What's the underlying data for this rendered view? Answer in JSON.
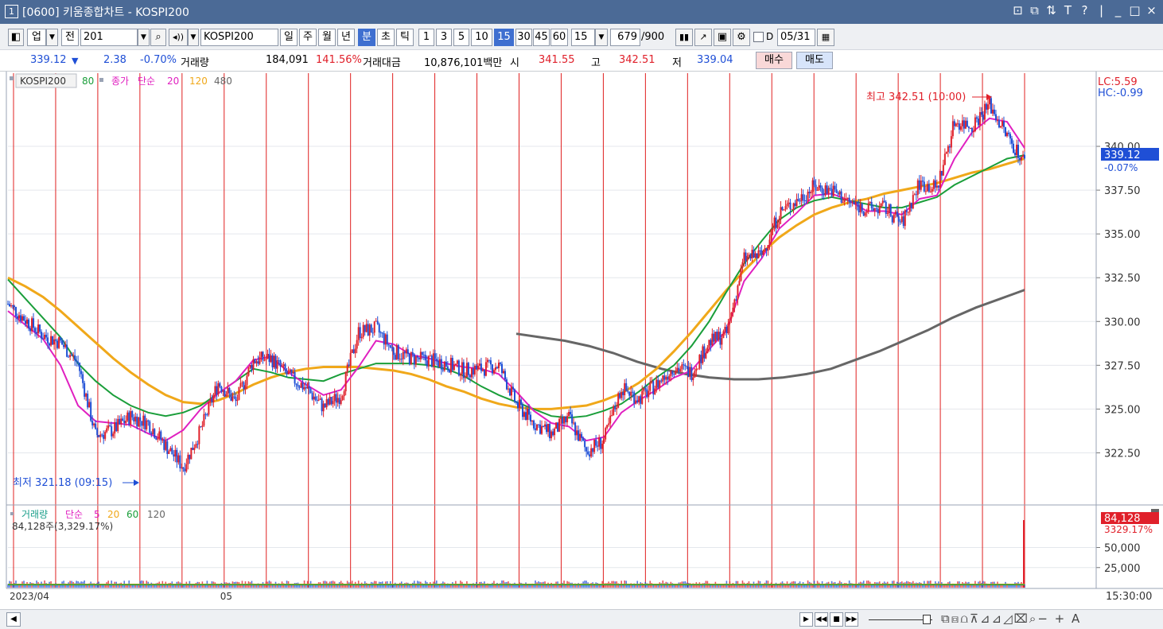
{
  "window": {
    "number": "1",
    "title": "[0600] 키움종합차트 - KOSPI200",
    "controls": [
      "⊡",
      "⧉",
      "⇅",
      "T",
      "?",
      "|",
      "_",
      "□",
      "×"
    ]
  },
  "toolbar": {
    "market": "업",
    "prev_label": "전",
    "code": "201",
    "symbol": "KOSPI200",
    "periods": [
      "일",
      "주",
      "월",
      "년",
      "분",
      "초",
      "틱"
    ],
    "active_period": "분",
    "intervals": [
      "1",
      "3",
      "5",
      "10",
      "15",
      "30",
      "45",
      "60"
    ],
    "active_interval": "15",
    "interval_value": "15",
    "count": "679",
    "count_max": "/900",
    "date_check": "D",
    "date": "05/31"
  },
  "quote": {
    "price": "339.12",
    "arrow": "▼",
    "change": "2.38",
    "change_pct": "-0.70%",
    "volume_label": "거래량",
    "volume": "184,091",
    "volume_ratio": "141.56%",
    "amount_label": "거래대금",
    "amount": "10,876,101백만",
    "open_label": "시",
    "open": "341.55",
    "high_label": "고",
    "high": "342.51",
    "low_label": "저",
    "low": "339.04",
    "buy_label": "매수",
    "sell_label": "매도"
  },
  "price_panel": {
    "legend_symbol": "KOSPI200",
    "legend_ma80": "80",
    "legend_close": "종가",
    "legend_simple": "단순",
    "legend_ma20": "20",
    "legend_ma120": "120",
    "legend_ma480": "480",
    "lc": "LC:5.59",
    "hc": "HC:-0.99",
    "high_annotation": "최고 342.51 (10:00)",
    "low_annotation": "최저 321.18 (09:15)",
    "current_tag": "339.12",
    "current_pct": "-0.07%"
  },
  "volume_panel": {
    "legend_volume": "거래량",
    "legend_simple": "단순",
    "legend_5": "5",
    "legend_20": "20",
    "legend_60": "60",
    "legend_120": "120",
    "value_line": "84,128주(3,329.17%)",
    "current_tag": "84,128",
    "current_pct": "3329.17%"
  },
  "x_axis": {
    "labels": [
      {
        "text": "2023/04",
        "slot": 0
      },
      {
        "text": "05",
        "slot": 5
      }
    ],
    "time": "15:30:00"
  },
  "colors": {
    "up": "#e0202a",
    "down": "#1f4fd6",
    "ma5": "#e020c0",
    "ma20": "#1a9e3a",
    "ma60": "#f0a81a",
    "ma120": "#666666",
    "grid_day": "#e02020",
    "title_bar": "#4b6a96"
  },
  "chart_data": {
    "type": "line",
    "title": "",
    "y_ticks": [
      340.0,
      337.5,
      335.0,
      332.5,
      330.0,
      327.5,
      325.0,
      322.5
    ],
    "y_tick_labels": [
      "340.00",
      "337.50",
      "335.00",
      "332.50",
      "330.00",
      "327.50",
      "325.00",
      "322.50"
    ],
    "ylim": [
      319.57,
      344.27
    ],
    "x_slots": 25,
    "close": [
      331.0,
      330.1,
      329.2,
      328.8,
      327.6,
      323.5,
      323.8,
      324.6,
      324.2,
      322.9,
      321.7,
      323.8,
      326.5,
      325.4,
      327.8,
      327.9,
      326.9,
      326.2,
      325.1,
      325.8,
      329.4,
      329.6,
      328.3,
      327.9,
      327.8,
      327.6,
      327.2,
      327.3,
      327.5,
      325.3,
      324.2,
      323.6,
      324.5,
      322.6,
      323.2,
      326.2,
      325.6,
      326.4,
      327.4,
      327.1,
      328.8,
      329.3,
      333.6,
      333.8,
      336.2,
      336.9,
      337.7,
      337.5,
      336.8,
      336.4,
      336.5,
      335.6,
      337.9,
      337.6,
      341.4,
      341.2,
      342.4,
      340.6,
      339.1
    ],
    "ma_short": [
      330.6,
      329.8,
      329.0,
      327.5,
      325.2,
      324.3,
      324.2,
      324.1,
      323.6,
      323.2,
      323.8,
      325.0,
      325.9,
      326.6,
      327.8,
      328.0,
      327.1,
      326.4,
      325.8,
      326.1,
      327.4,
      328.9,
      328.7,
      328.1,
      327.9,
      327.6,
      327.4,
      327.3,
      327.0,
      326.0,
      324.9,
      324.2,
      324.0,
      323.2,
      323.4,
      324.8,
      325.5,
      326.1,
      326.8,
      327.2,
      328.4,
      329.5,
      332.3,
      333.6,
      335.3,
      336.2,
      337.2,
      337.3,
      336.9,
      336.3,
      336.3,
      336.1,
      337.0,
      337.2,
      339.3,
      340.8,
      341.6,
      341.4,
      339.9
    ],
    "ma20": [
      332.4,
      331.3,
      330.2,
      329.1,
      327.6,
      326.6,
      325.8,
      325.2,
      324.8,
      324.6,
      324.8,
      325.2,
      325.9,
      326.6,
      327.3,
      327.1,
      326.8,
      326.7,
      326.6,
      327.0,
      327.3,
      327.6,
      327.6,
      327.6,
      327.5,
      327.3,
      326.9,
      326.3,
      325.8,
      325.4,
      325.0,
      324.6,
      324.5,
      324.6,
      324.9,
      325.3,
      326.0,
      326.8,
      327.5,
      328.6,
      330.0,
      331.7,
      333.3,
      334.6,
      335.8,
      336.5,
      336.9,
      337.1,
      336.9,
      336.7,
      336.5,
      336.5,
      336.8,
      337.1,
      337.8,
      338.3,
      338.8,
      339.3,
      339.5
    ],
    "ma60": [
      332.5,
      332.0,
      331.4,
      330.6,
      329.7,
      328.8,
      327.9,
      327.1,
      326.4,
      325.8,
      325.4,
      325.3,
      325.5,
      325.9,
      326.4,
      326.8,
      327.1,
      327.3,
      327.4,
      327.4,
      327.4,
      327.3,
      327.2,
      327.0,
      326.7,
      326.3,
      326.0,
      325.6,
      325.3,
      325.1,
      325.0,
      325.0,
      325.1,
      325.2,
      325.5,
      325.9,
      326.5,
      327.3,
      328.3,
      329.4,
      330.6,
      331.8,
      332.9,
      333.9,
      334.8,
      335.5,
      336.1,
      336.5,
      336.8,
      337.0,
      337.3,
      337.5,
      337.7,
      337.9,
      338.2,
      338.5,
      338.7,
      339.0,
      339.3
    ],
    "ma120": [
      null,
      null,
      null,
      null,
      null,
      null,
      null,
      null,
      null,
      null,
      null,
      null,
      null,
      null,
      null,
      null,
      null,
      null,
      null,
      null,
      null,
      329.3,
      329.1,
      328.9,
      328.6,
      328.2,
      327.7,
      327.3,
      327.0,
      326.8,
      326.7,
      326.7,
      326.8,
      327.0,
      327.3,
      327.8,
      328.3,
      328.9,
      329.5,
      330.2,
      330.8,
      331.3,
      331.8
    ],
    "volume_ticks": [
      "50,000",
      "25,000"
    ],
    "volume_max": 100000,
    "volume_last": 84128
  }
}
